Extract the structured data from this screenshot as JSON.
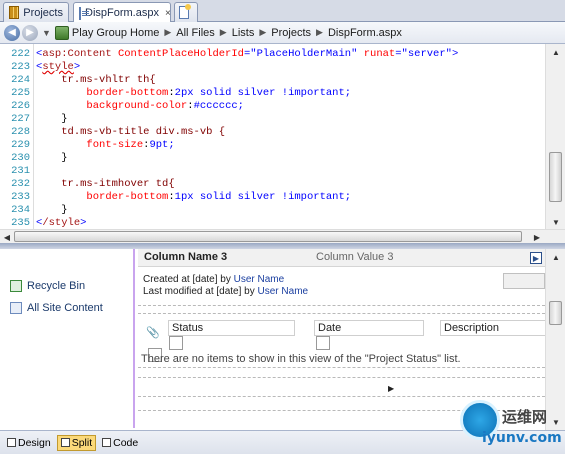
{
  "tabs": [
    {
      "label": "Projects",
      "icon": "grid-icon",
      "active": false
    },
    {
      "label": "DispForm.aspx",
      "icon": "page-icon",
      "active": true,
      "close": "×"
    }
  ],
  "breadcrumb": [
    "Play Group Home",
    "All Files",
    "Lists",
    "Projects",
    "DispForm.aspx"
  ],
  "code": {
    "lines": [
      {
        "n": "222"
      },
      {
        "n": "223"
      },
      {
        "n": "224"
      },
      {
        "n": "225"
      },
      {
        "n": "226"
      },
      {
        "n": "227"
      },
      {
        "n": "228"
      },
      {
        "n": "229"
      },
      {
        "n": "230"
      },
      {
        "n": "231"
      },
      {
        "n": "232"
      },
      {
        "n": "233"
      },
      {
        "n": "234"
      },
      {
        "n": "235"
      }
    ],
    "l222": {
      "tag": "asp:Content",
      "a1": "ContentPlaceHolderId",
      "v1": "\"PlaceHolderMain\"",
      "a2": "runat",
      "v2": "\"server\""
    },
    "l223": {
      "tag": "style"
    },
    "l224": {
      "sel": "tr.ms-vhltr th{"
    },
    "l225": {
      "prop": "border-bottom",
      "val": "2px solid silver !important;"
    },
    "l226": {
      "prop": "background-color",
      "val": "#cccccc;"
    },
    "l227": {
      "text": "}"
    },
    "l228": {
      "sel": "td.ms-vb-title div.ms-vb {"
    },
    "l229": {
      "prop": "font-size",
      "val": "9pt;"
    },
    "l230": {
      "text": "}"
    },
    "l232": {
      "sel": "tr.ms-itmhover td{"
    },
    "l233": {
      "prop": "border-bottom",
      "val": "1px solid silver !important;"
    },
    "l234": {
      "text": "}"
    },
    "l235": {
      "tag": "/style"
    }
  },
  "design": {
    "leftnav": [
      {
        "label": "Recycle Bin",
        "icon": "recycle-bin-icon"
      },
      {
        "label": "All Site Content",
        "icon": "site-content-icon"
      }
    ],
    "column_header": {
      "name": "Column Name 3",
      "value": "Column Value 3"
    },
    "created": {
      "prefix": "Created at [date] by",
      "user": "User Name"
    },
    "modified": {
      "prefix": "Last modified at [date] by",
      "user": "User Name"
    },
    "columns": [
      "Status",
      "Date",
      "Description"
    ],
    "empty_message": "There are no items to show in this view of the \"Project Status\" list."
  },
  "viewbar": {
    "design": "Design",
    "split": "Split",
    "code": "Code",
    "active": "Split"
  },
  "watermark": {
    "text1": "运维网",
    "text2": "iyunv.com"
  }
}
